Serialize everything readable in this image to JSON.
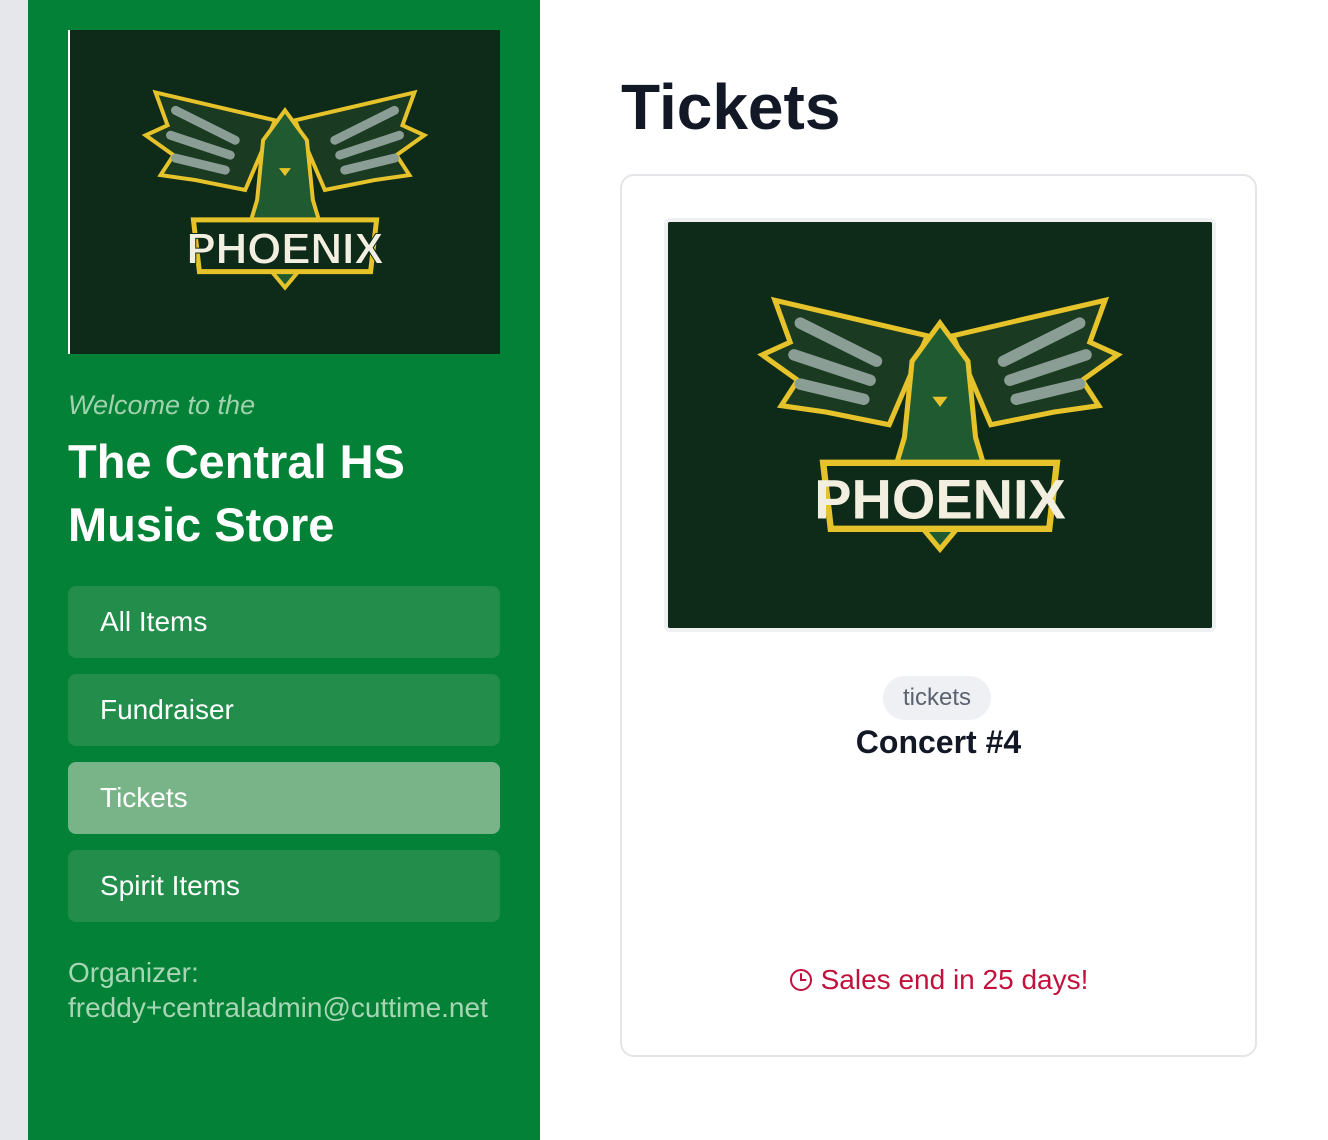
{
  "sidebar": {
    "logo_text": "PHOENIX",
    "welcome": "Welcome to the",
    "store_name": "The Central HS Music Store",
    "nav": [
      {
        "label": "All Items",
        "active": false
      },
      {
        "label": "Fundraiser",
        "active": false
      },
      {
        "label": "Tickets",
        "active": true
      },
      {
        "label": "Spirit Items",
        "active": false
      }
    ],
    "organizer_label": "Organizer:",
    "organizer_email": "freddy+centraladmin@cuttime.net"
  },
  "main": {
    "title": "Tickets",
    "products": [
      {
        "image_text": "PHOENIX",
        "tag": "tickets",
        "name": "Concert #4",
        "sales_end": "Sales end in 25 days!",
        "icon": "clock-icon"
      }
    ]
  },
  "colors": {
    "sidebar": "#038136",
    "nav_item": "#238d4b",
    "nav_item_active": "#79b489",
    "sales_end": "#c1123d"
  }
}
